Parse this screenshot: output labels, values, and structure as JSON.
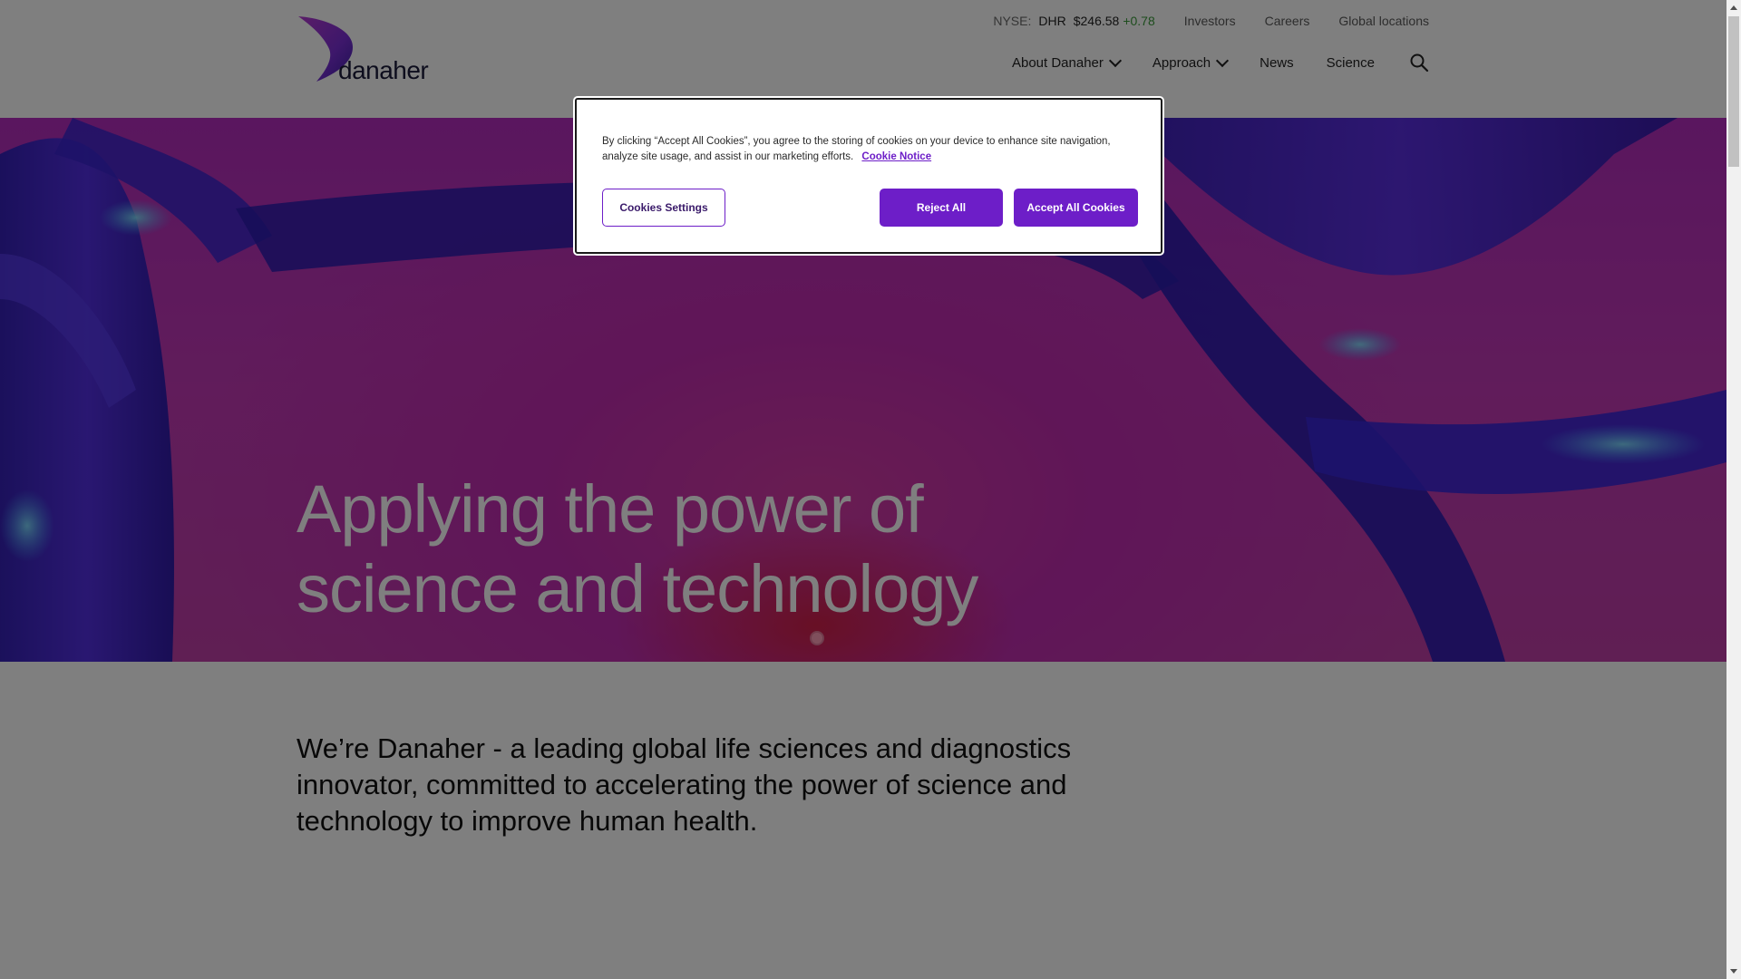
{
  "brand": {
    "name": "danaher"
  },
  "utility": {
    "stock": {
      "exchange": "NYSE:",
      "symbol": "DHR",
      "price": "$246.58",
      "change": "+0.78"
    },
    "links": [
      "Investors",
      "Careers",
      "Global locations"
    ]
  },
  "nav": {
    "items": [
      {
        "label": "About Danaher",
        "has_dropdown": true
      },
      {
        "label": "Approach",
        "has_dropdown": true
      },
      {
        "label": "News",
        "has_dropdown": false
      },
      {
        "label": "Science",
        "has_dropdown": false
      }
    ],
    "search_icon": "search-icon"
  },
  "hero": {
    "title_line1": "Applying the power of",
    "title_line2": "science and technology"
  },
  "intro": {
    "text": "We’re Danaher - a leading global life sciences and diagnostics innovator, committed to accelerating the power of science and technology to improve human health."
  },
  "cookie": {
    "message": "By clicking “Accept All Cookies”, you agree to the storing of cookies on your device to enhance site navigation, analyze site usage, and assist in our marketing efforts.",
    "notice_link": "Cookie Notice",
    "settings_button": "Cookies Settings",
    "reject_button": "Reject All",
    "accept_button": "Accept All Cookies"
  },
  "colors": {
    "accent": "#6d1ec8",
    "stock_up": "#3a9a3a",
    "hero_magenta": "#c02cb0",
    "hero_blue": "#3d2be0"
  }
}
